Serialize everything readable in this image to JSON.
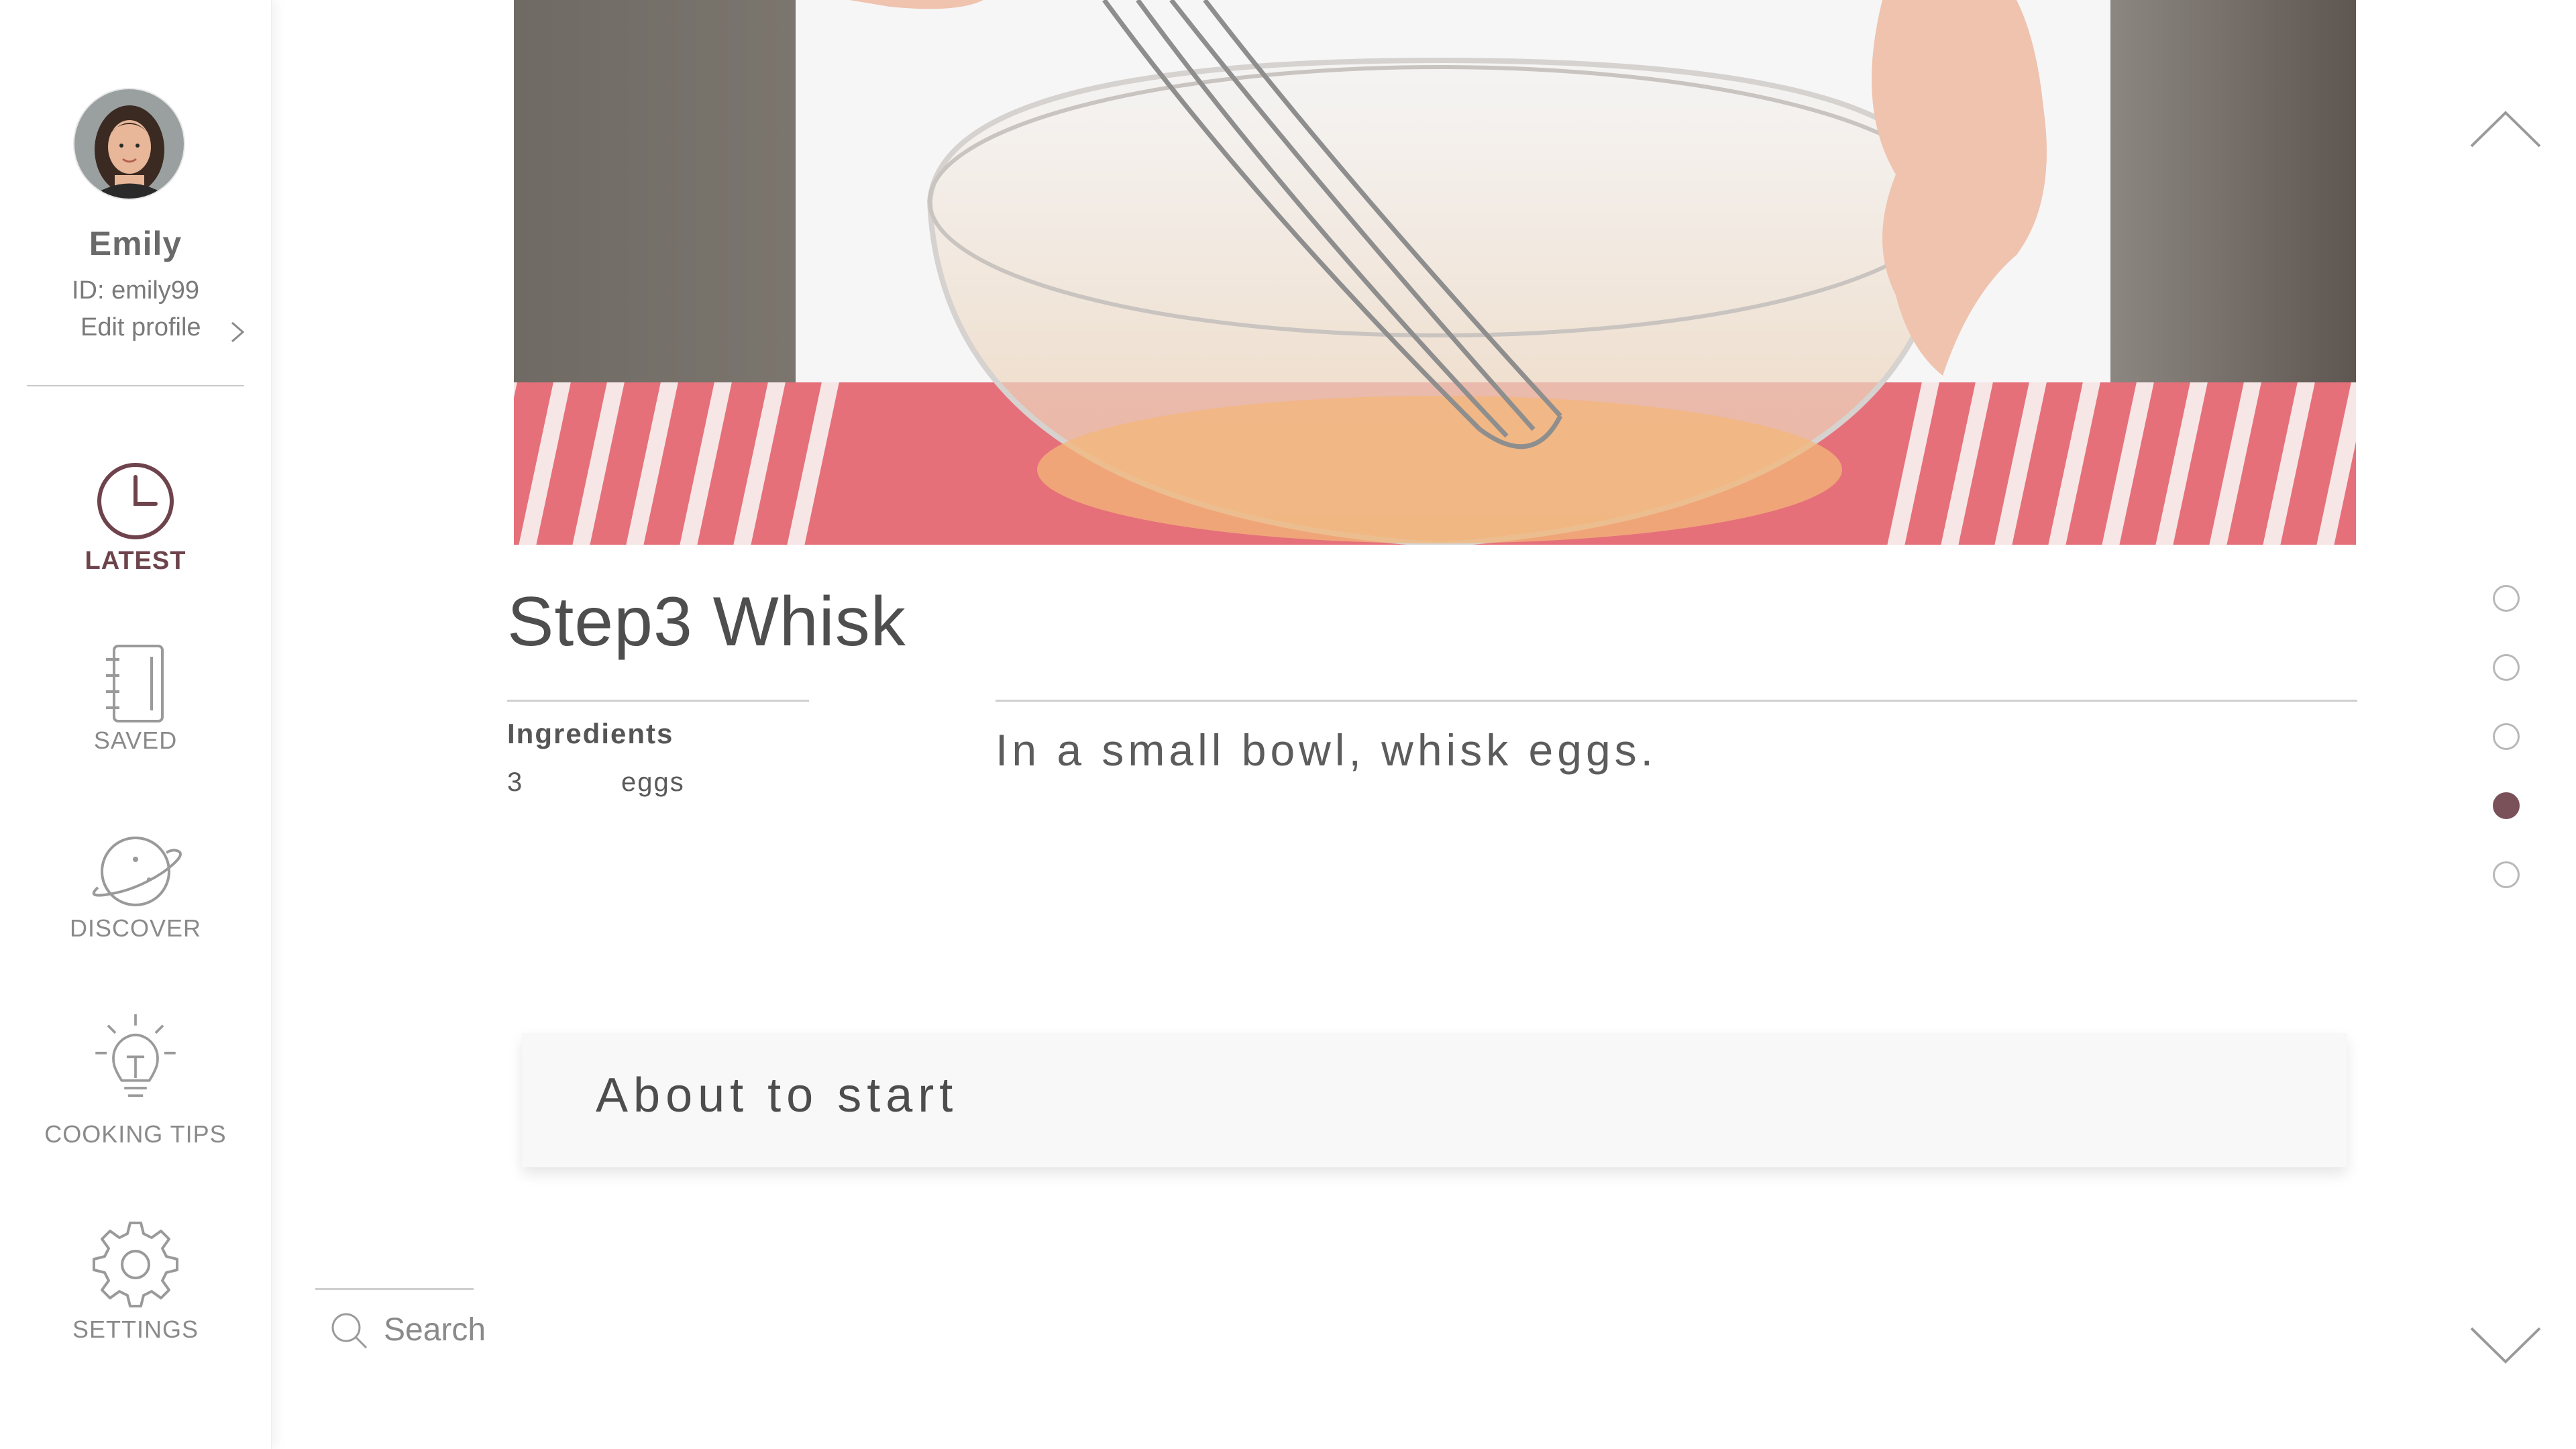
{
  "profile": {
    "name": "Emily",
    "id_text": "ID: emily99",
    "edit_label": "Edit profile"
  },
  "nav": [
    {
      "label": "LATEST",
      "icon": "clock-icon",
      "active": true
    },
    {
      "label": "SAVED",
      "icon": "notebook-icon",
      "active": false
    },
    {
      "label": "DISCOVER",
      "icon": "planet-icon",
      "active": false
    },
    {
      "label": "COOKING TIPS",
      "icon": "lightbulb-icon",
      "active": false
    },
    {
      "label": "SETTINGS",
      "icon": "gear-icon",
      "active": false
    }
  ],
  "search": {
    "label": "Search"
  },
  "step": {
    "title": "Step3 Whisk",
    "ingredients_heading": "Ingredients",
    "ingredients": [
      {
        "qty": "3",
        "name": "eggs"
      }
    ],
    "instruction": "In a small bowl, whisk eggs."
  },
  "status": {
    "text": "About to start"
  },
  "pager": {
    "total_steps": 5,
    "current_step": 4
  },
  "colors": {
    "accent": "#6e434b",
    "dot_active": "#7a5159",
    "text": "#5c5c5c"
  }
}
